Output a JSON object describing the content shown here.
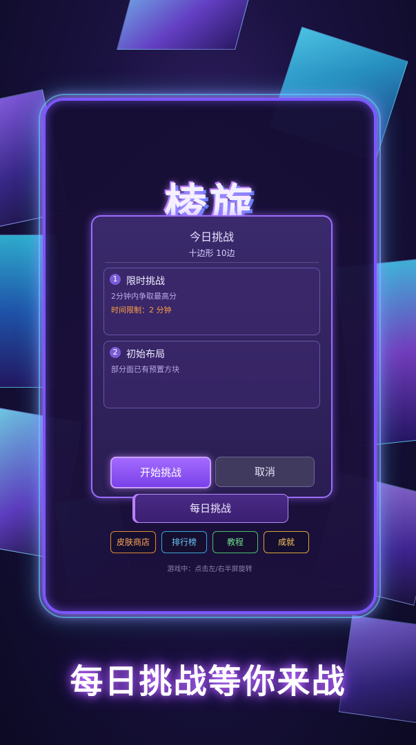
{
  "game": {
    "logo": "棱旋",
    "tagline": "每日挑战等你来战"
  },
  "dialog": {
    "title": "今日挑战",
    "subtitle": "十边形  10边",
    "rules": [
      {
        "num": "1",
        "title": "限时挑战",
        "desc": "2分钟内争取最高分",
        "limit": "时间限制：2 分钟"
      },
      {
        "num": "2",
        "title": "初始布局",
        "desc": "部分面已有预置方块"
      }
    ],
    "start_label": "开始挑战",
    "cancel_label": "取消"
  },
  "menu": {
    "daily_label": "每日挑战",
    "chips": [
      "皮肤商店",
      "排行榜",
      "教程",
      "成就"
    ],
    "hint": "游戏中：点击左/右半屏旋转"
  },
  "colors": {
    "accent": "#9b6dff",
    "cyan_glow": "#50dcff",
    "limit_orange": "#ff9f43"
  }
}
